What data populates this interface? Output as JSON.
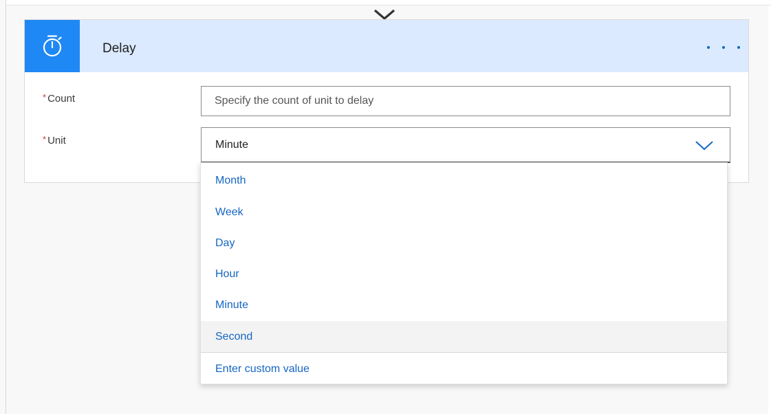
{
  "card": {
    "title": "Delay",
    "icon": "timer-icon",
    "menu_icon": "more-horizontal-icon",
    "header_color": "#dbeafe",
    "icon_tile_color": "#1e88f4"
  },
  "fields": {
    "required_marker": "*",
    "count": {
      "label": "Count",
      "value": "",
      "placeholder": "Specify the count of unit to delay"
    },
    "unit": {
      "label": "Unit",
      "selected": "Minute",
      "icon": "chevron-down-icon"
    }
  },
  "dropdown": {
    "options": [
      "Month",
      "Week",
      "Day",
      "Hour",
      "Minute",
      "Second"
    ],
    "highlighted": "Second",
    "custom_option": "Enter custom value",
    "option_color": "#1466c2"
  }
}
